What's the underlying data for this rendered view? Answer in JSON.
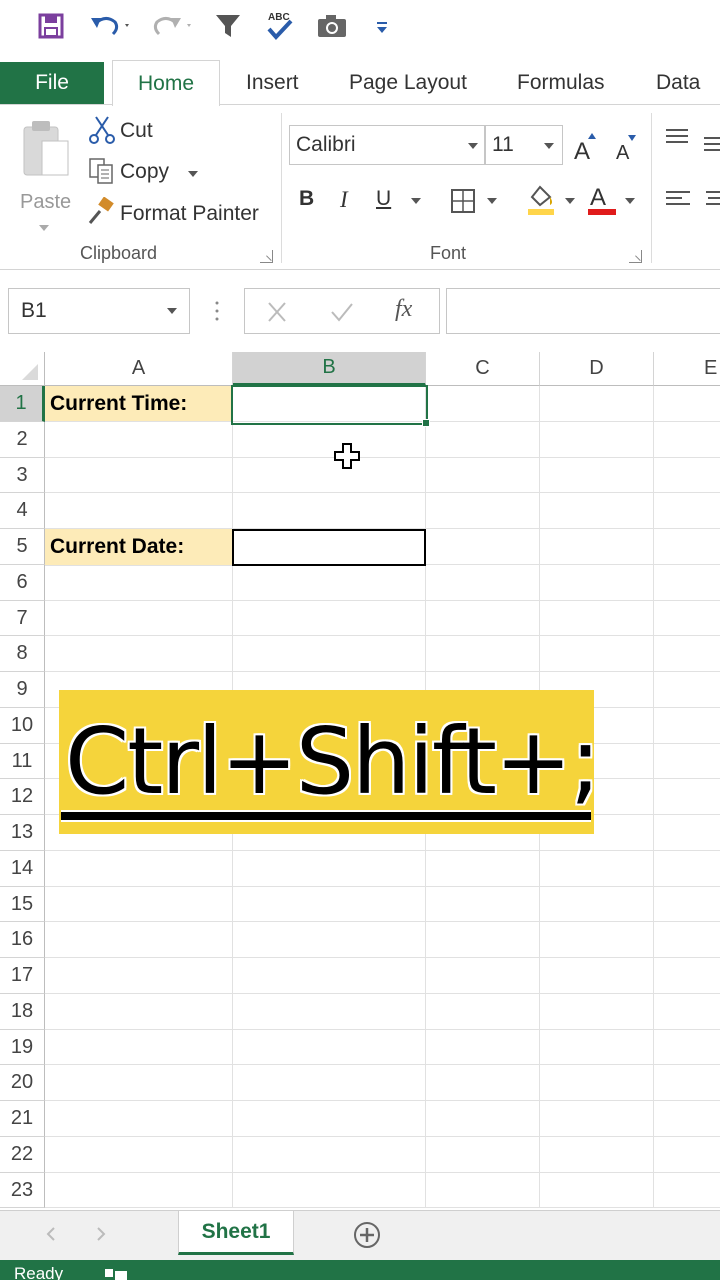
{
  "ribbon_tabs": {
    "file": "File",
    "home": "Home",
    "insert": "Insert",
    "page_layout": "Page Layout",
    "formulas": "Formulas",
    "data": "Data"
  },
  "clipboard": {
    "paste": "Paste",
    "cut": "Cut",
    "copy": "Copy",
    "format_painter": "Format Painter",
    "group_label": "Clipboard"
  },
  "font": {
    "family": "Calibri",
    "size": "11",
    "bold": "B",
    "italic": "I",
    "underline": "U",
    "group_label": "Font"
  },
  "formula_bar": {
    "name_box": "B1",
    "fx": "fx",
    "value": ""
  },
  "grid": {
    "columns": [
      "A",
      "B",
      "C",
      "D",
      "E"
    ],
    "rows": [
      "1",
      "2",
      "3",
      "4",
      "5",
      "6",
      "7",
      "8",
      "9",
      "10",
      "11",
      "12",
      "13",
      "14",
      "15",
      "16",
      "17",
      "18",
      "19",
      "20",
      "21",
      "22",
      "23"
    ],
    "selected_cell": "B1",
    "cells": {
      "A1": "Current Time:",
      "A5": "Current Date:"
    }
  },
  "caption": "Ctrl+Shift+;",
  "sheets": {
    "active": "Sheet1"
  },
  "status": {
    "text": "Ready"
  },
  "colors": {
    "excel_green": "#217346",
    "label_fill": "#fdebb8",
    "caption_bg": "#f5d43b"
  }
}
